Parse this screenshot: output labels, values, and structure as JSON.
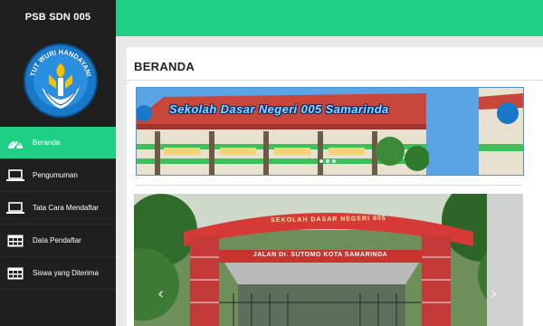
{
  "brand": {
    "title": "PSB SDN 005",
    "logo_text": "TUT WURI HANDAYANI"
  },
  "sidebar": {
    "items": [
      {
        "label": "Beranda",
        "icon": "dashboard-icon",
        "active": true
      },
      {
        "label": "Pengumuman",
        "icon": "laptop-icon",
        "active": false
      },
      {
        "label": "Tata Cara Mendaftar",
        "icon": "laptop-icon",
        "active": false
      },
      {
        "label": "Data Pendaftar",
        "icon": "table-icon",
        "active": false
      },
      {
        "label": "Siswa yang Diterima",
        "icon": "table-icon",
        "active": false
      }
    ]
  },
  "main": {
    "page_title": "BERANDA",
    "banner": {
      "caption": "Sekolah Dasar Negeri 005 Samarinda"
    },
    "gate": {
      "arch_text": "SEKOLAH DASAR NEGERI 005",
      "sign_text": "JALAN Dr. SUTOMO KOTA SAMARINDA"
    },
    "slider": {
      "prev_symbol": "‹",
      "next_symbol": "›"
    }
  },
  "colors": {
    "accent": "#1fcf86",
    "sidebar_bg": "#1f1f1f",
    "banner_bg": "#5aa3e4"
  }
}
